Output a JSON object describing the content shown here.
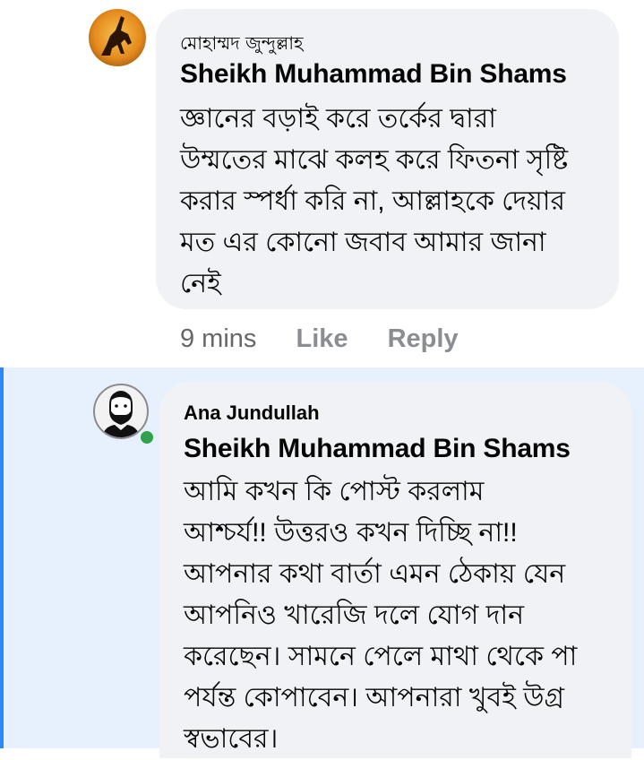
{
  "comments": [
    {
      "author_name": "মোহাম্মদ জুন্দুল্লাহ",
      "tagged_name": "Sheikh Muhammad Bin Shams",
      "text": "জ্ঞানের বড়াই করে তর্কের দ্বারা\nউম্মতের মাঝে কলহ করে ফিতনা সৃষ্টি\nকরার স্পর্ধা করি না, আল্লাহকে দেয়ার\nমত এর কোনো জবাব আমার জানা\nনেই",
      "time": "9 mins",
      "like_label": "Like",
      "reply_label": "Reply"
    },
    {
      "author_name": "Ana Jundullah",
      "tagged_name": "Sheikh Muhammad Bin Shams",
      "text": "আমি কখন কি পোস্ট করলাম\nআশ্চর্য!! উত্তরও কখন দিচ্ছি না!!\nআপনার কথা বার্তা এমন ঠেকায় যেন\nআপনিও খারেজি দলে যোগ দান\nকরেছেন। সামনে পেলে মাথা থেকে পা\nপর্যন্ত কোপাবেন। আপনারা খুবই উগ্র\nস্বভাবের।",
      "online": true
    }
  ],
  "colors": {
    "bubble": "#f0f2f5",
    "highlight_bg": "#e7f1fd",
    "highlight_border": "#2d88ff",
    "online": "#31a24c"
  }
}
